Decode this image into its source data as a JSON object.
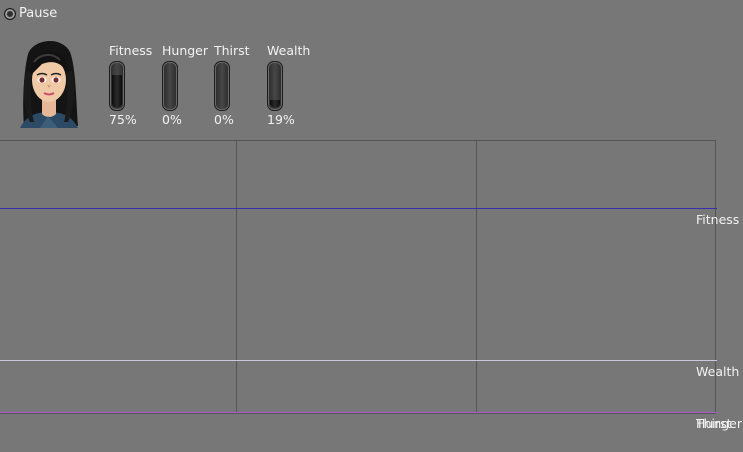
{
  "pause": {
    "label": "Pause",
    "checked": false
  },
  "avatar": {
    "icon": "girl-avatar-icon"
  },
  "stats": [
    {
      "key": "fitness",
      "label": "Fitness",
      "value_text": "75%",
      "value": 0.75
    },
    {
      "key": "hunger",
      "label": "Hunger",
      "value_text": "0%",
      "value": 0.0
    },
    {
      "key": "thirst",
      "label": "Thirst",
      "value_text": "0%",
      "value": 0.0
    },
    {
      "key": "wealth",
      "label": "Wealth",
      "value_text": "19%",
      "value": 0.19
    }
  ],
  "graph": {
    "series": [
      {
        "name": "Fitness",
        "value": 0.75,
        "color": "#3a2fa8"
      },
      {
        "name": "Wealth",
        "value": 0.19,
        "color": "#c8c8e0"
      },
      {
        "name": "Thirst",
        "value": 0.0,
        "color": "#8a3ab0"
      },
      {
        "name": "Hunger",
        "value": 0.0,
        "color": "#b05ad0"
      }
    ]
  },
  "colors": {
    "background": "#777777",
    "grid": "#555555",
    "text": "#f2f2f2"
  }
}
